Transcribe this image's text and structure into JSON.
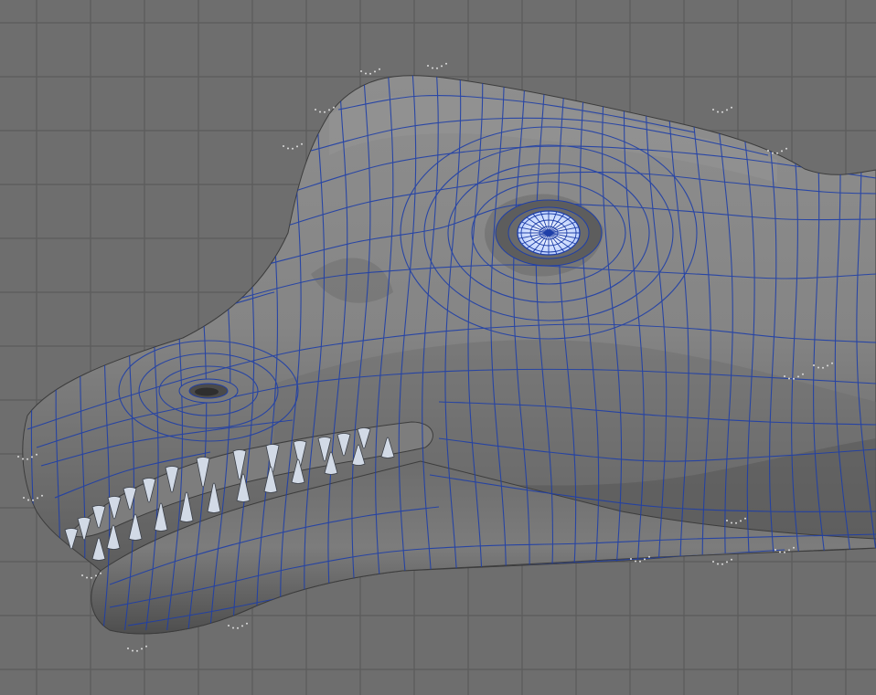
{
  "viewport": {
    "background_color": "#6e6e6e",
    "grid_color": "#5c5c5c",
    "grid_visible": true
  },
  "model": {
    "subject": "dinosaur-head",
    "surface_color": "#8a8a8a",
    "surface_shadow_color": "#4a4a4a",
    "wireframe_color": "#1f3fa8",
    "eye_color": "#d8e4ff",
    "teeth_color": "#d2dae6"
  }
}
